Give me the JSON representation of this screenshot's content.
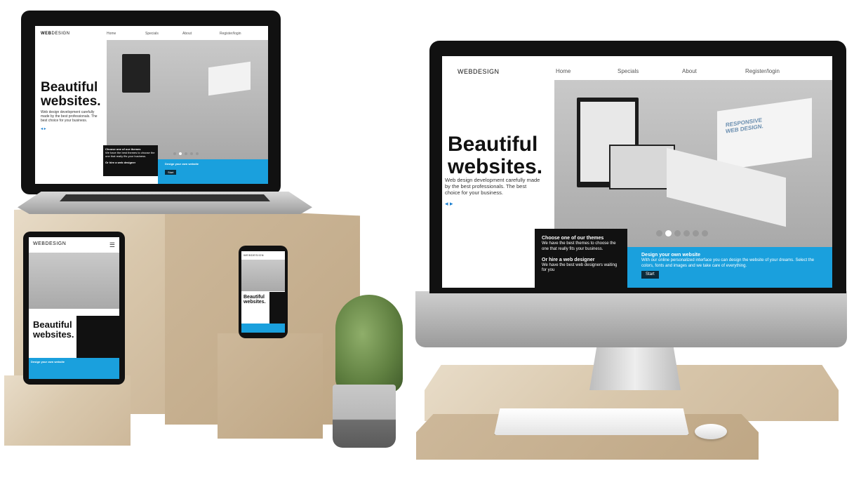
{
  "site": {
    "logo_bold": "WEB",
    "logo_rest": "DESIGN",
    "nav": [
      "Home",
      "Specials",
      "About",
      "Register/login"
    ],
    "headline_line1": "Beautiful",
    "headline_line2": "websites.",
    "tagline": "Web design development carefully made by the best professionals. The best choice for your business.",
    "themes_title": "Choose one of our themes",
    "themes_text": "We have the best themes to choose the one that really fits your business.",
    "designer_title": "Or hire a web designer",
    "designer_text": "We have the best web designers waiting for you",
    "design_title": "Design your own website",
    "design_text": "With our online personalized interface you can design the website of your dreams. Select the colors, fonts and images and we take care of everything.",
    "start_label": "Start",
    "arrows": "◂ ▸",
    "hero_card_text": "RESPONSIVE WEB DESIGN."
  },
  "colors": {
    "accent_blue": "#1aa0dd",
    "black_panel": "#111111",
    "wood": "#d9c8ad"
  }
}
